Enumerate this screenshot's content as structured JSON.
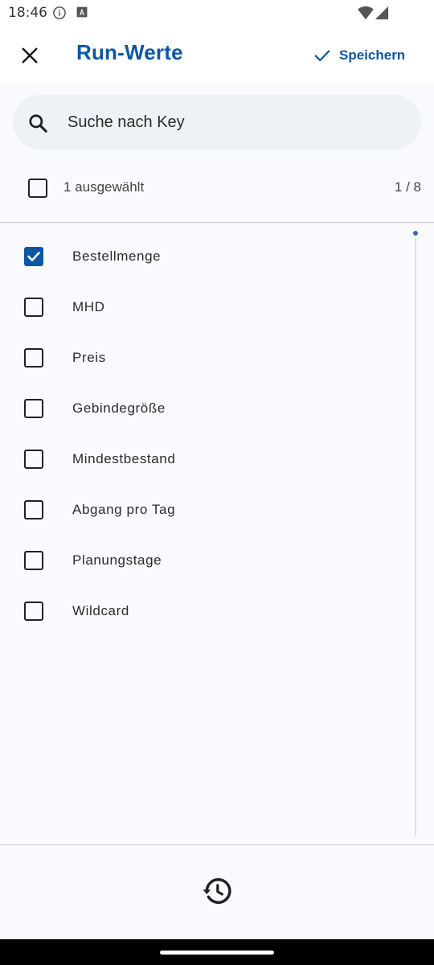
{
  "status_bar": {
    "time": "18:46"
  },
  "app_bar": {
    "title": "Run-Werte",
    "save_label": "Speichern"
  },
  "search": {
    "placeholder": "Suche nach Key",
    "value": ""
  },
  "selection": {
    "selected_text": "1 ausgewählt",
    "page_text": "1 / 8"
  },
  "items": [
    {
      "label": "Bestellmenge",
      "checked": true
    },
    {
      "label": "MHD",
      "checked": false
    },
    {
      "label": "Preis",
      "checked": false
    },
    {
      "label": "Gebindegröße",
      "checked": false
    },
    {
      "label": "Mindestbestand",
      "checked": false
    },
    {
      "label": "Abgang pro Tag",
      "checked": false
    },
    {
      "label": "Planungstage",
      "checked": false
    },
    {
      "label": "Wildcard",
      "checked": false
    }
  ],
  "colors": {
    "accent": "#0b57a4",
    "background": "#f8fafd",
    "search_bg": "#eef1f5"
  },
  "icons": {
    "close": "close-icon",
    "save": "check-icon",
    "search": "search-icon",
    "history": "history-icon"
  }
}
